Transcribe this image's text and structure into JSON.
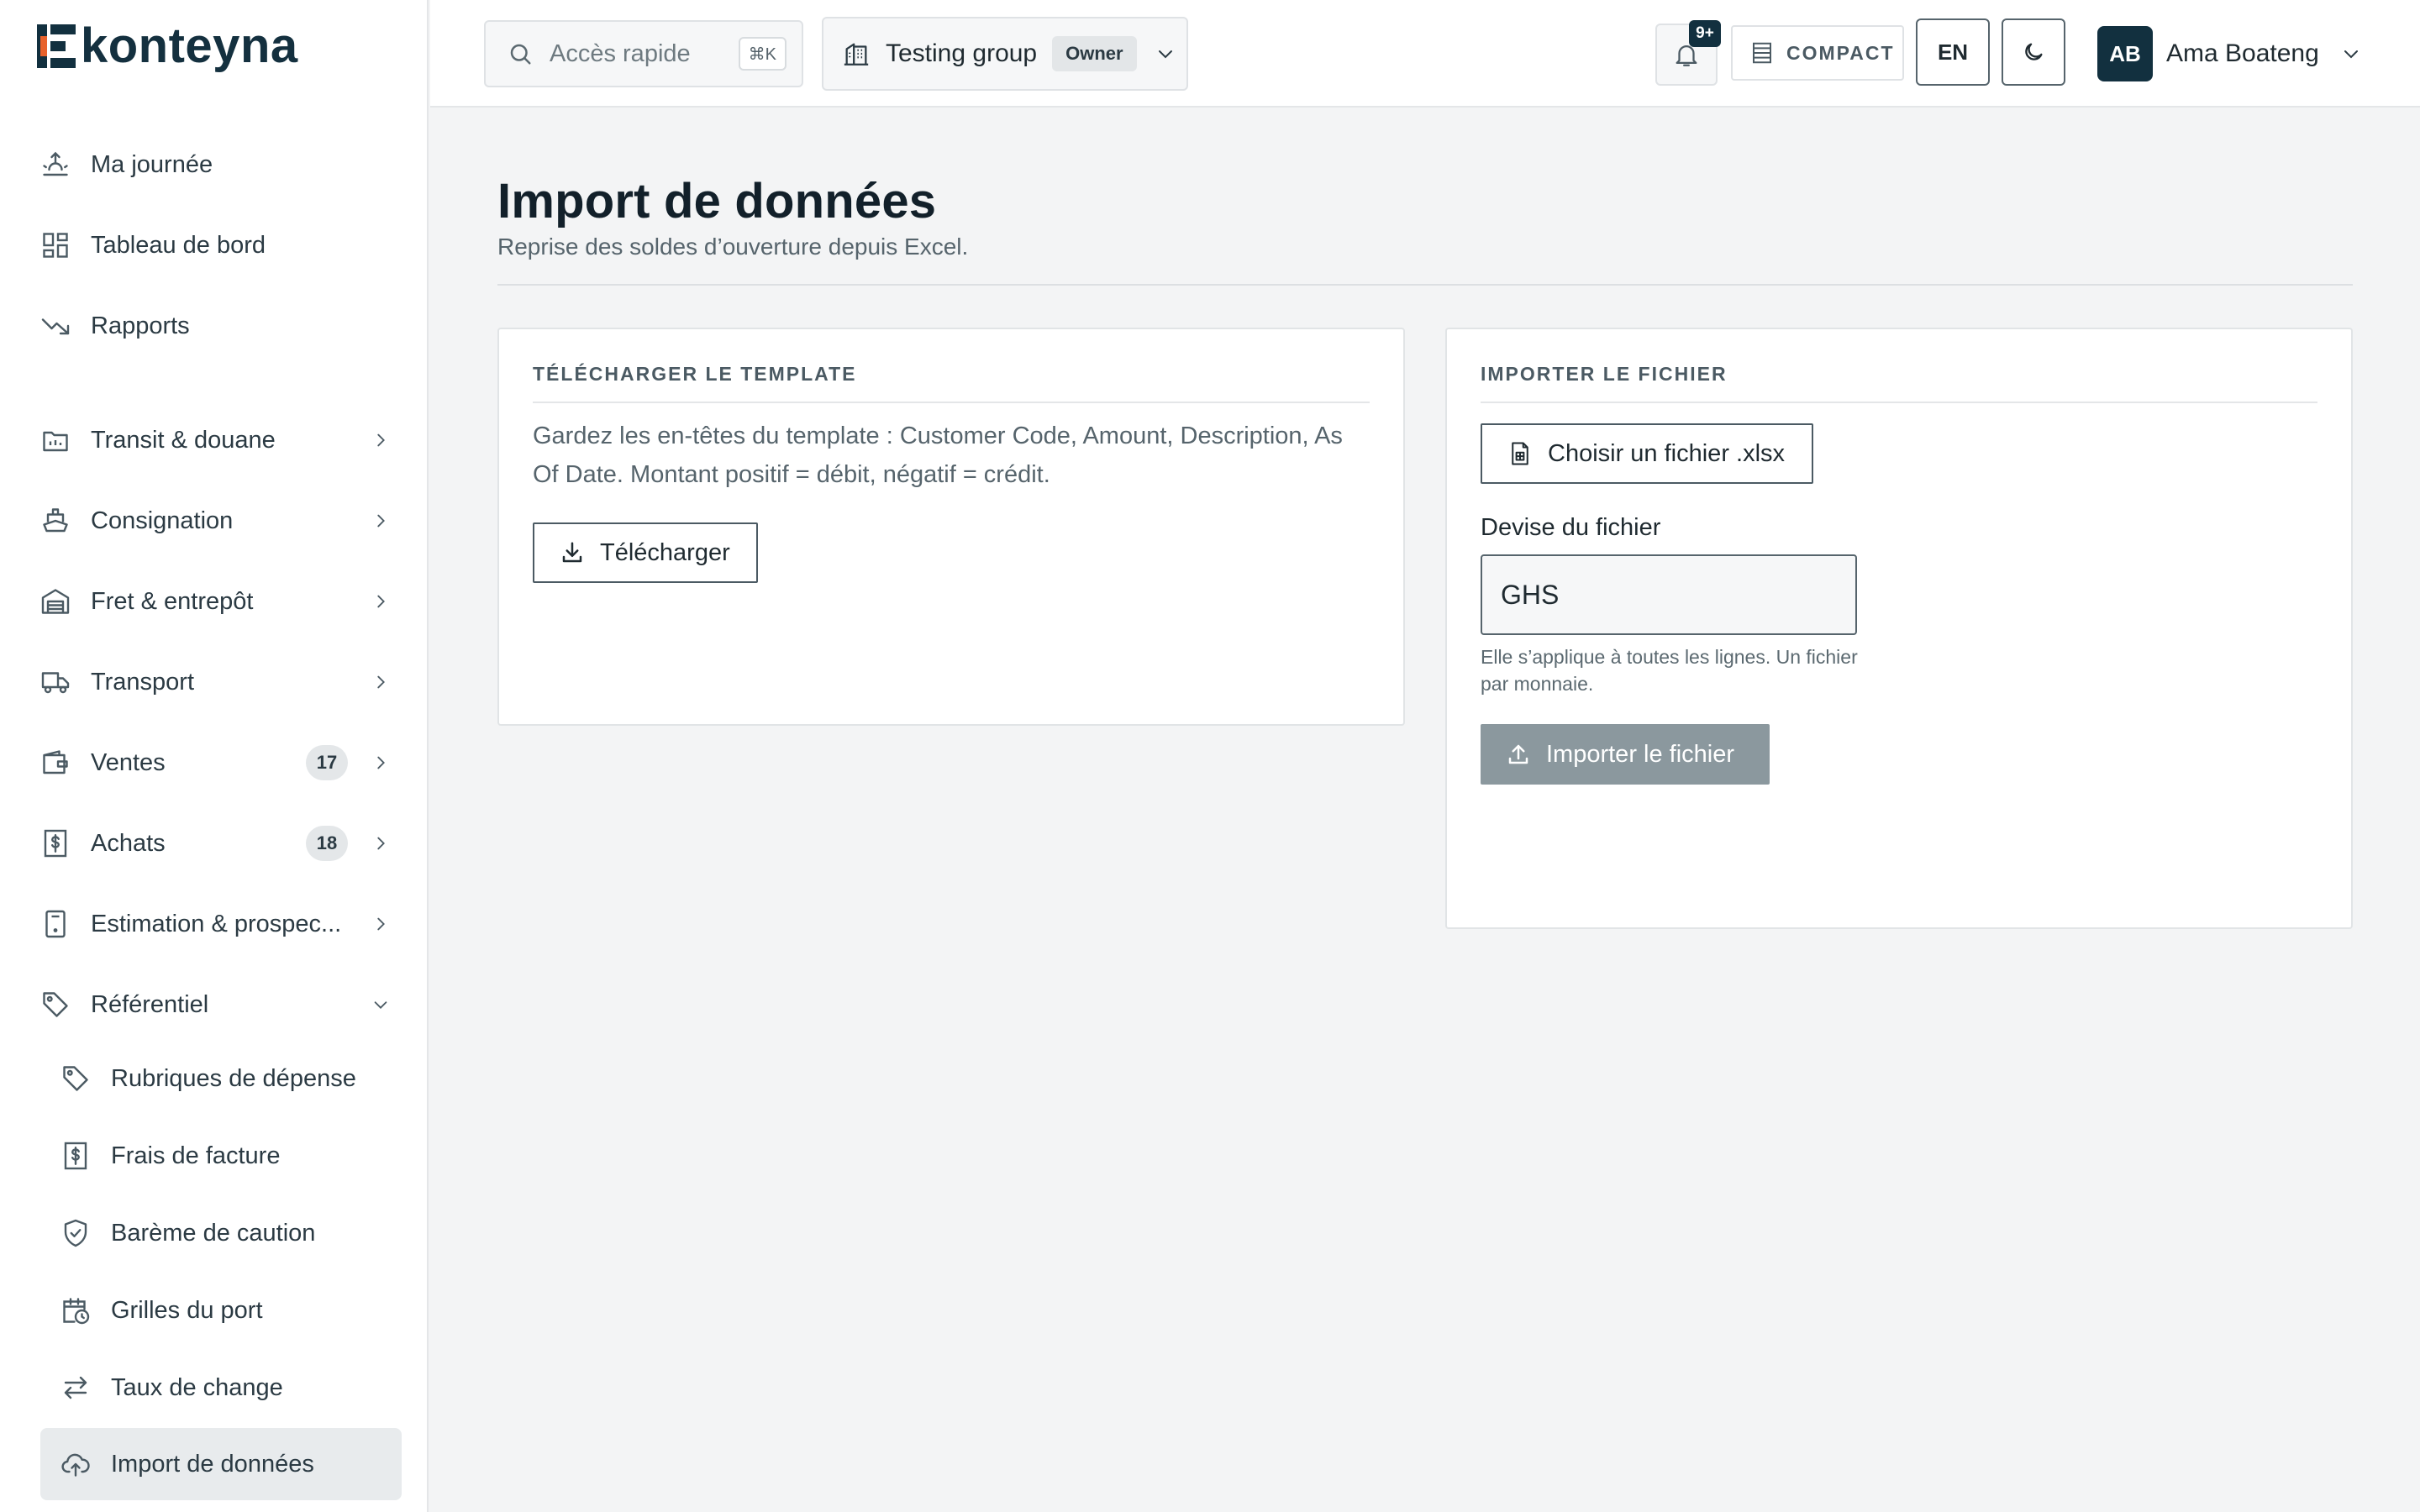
{
  "app": {
    "logo_text": "konteyna"
  },
  "sidebar": {
    "items": [
      {
        "label": "Ma journée",
        "icon": "sunrise-icon"
      },
      {
        "label": "Tableau de bord",
        "icon": "dashboard-icon"
      },
      {
        "label": "Rapports",
        "icon": "trending-down-icon"
      },
      {
        "label": "Transit & douane",
        "icon": "folder-icon"
      },
      {
        "label": "Consignation",
        "icon": "ship-icon"
      },
      {
        "label": "Fret & entrepôt",
        "icon": "warehouse-icon"
      },
      {
        "label": "Transport",
        "icon": "truck-icon"
      },
      {
        "label": "Ventes",
        "icon": "wallet-icon",
        "badge": "17"
      },
      {
        "label": "Achats",
        "icon": "dollar-receipt-icon",
        "badge": "18"
      },
      {
        "label": "Estimation & prospec...",
        "icon": "calculator-icon"
      },
      {
        "label": "Référentiel",
        "icon": "tag-icon"
      }
    ],
    "sub_items": [
      {
        "label": "Rubriques de dépense",
        "icon": "tag-icon"
      },
      {
        "label": "Frais de facture",
        "icon": "dollar-receipt-icon"
      },
      {
        "label": "Barème de caution",
        "icon": "shield-check-icon"
      },
      {
        "label": "Grilles du port",
        "icon": "calendar-clock-icon"
      },
      {
        "label": "Taux de change",
        "icon": "swap-arrows-icon"
      },
      {
        "label": "Import de données",
        "icon": "cloud-upload-icon",
        "active": true
      }
    ]
  },
  "topbar": {
    "quick_access": {
      "placeholder": "Accès rapide",
      "shortcut": "⌘K"
    },
    "group": {
      "name": "Testing group",
      "role": "Owner"
    },
    "notifications": {
      "count": "9+"
    },
    "density": {
      "label": "COMPACT"
    },
    "language": "EN",
    "user": {
      "initials": "AB",
      "name": "Ama Boateng"
    }
  },
  "page": {
    "title": "Import de données",
    "subtitle": "Reprise des soldes d’ouverture depuis Excel."
  },
  "template_card": {
    "heading": "TÉLÉCHARGER LE TEMPLATE",
    "text": "Gardez les en-têtes du template : Customer Code, Amount, Description, As Of Date. Montant positif = débit, négatif = crédit.",
    "download_label": "Télécharger"
  },
  "import_card": {
    "heading": "IMPORTER LE FICHIER",
    "choose_label": "Choisir un fichier .xlsx",
    "currency_label": "Devise du fichier",
    "currency_value": "GHS",
    "hint": "Elle s’applique à toutes les lignes. Un fichier par monnaie.",
    "import_label": "Importer le fichier"
  },
  "colors": {
    "brand": "#12303f",
    "primary_disabled": "#8b989e",
    "background": "#f3f4f5"
  }
}
